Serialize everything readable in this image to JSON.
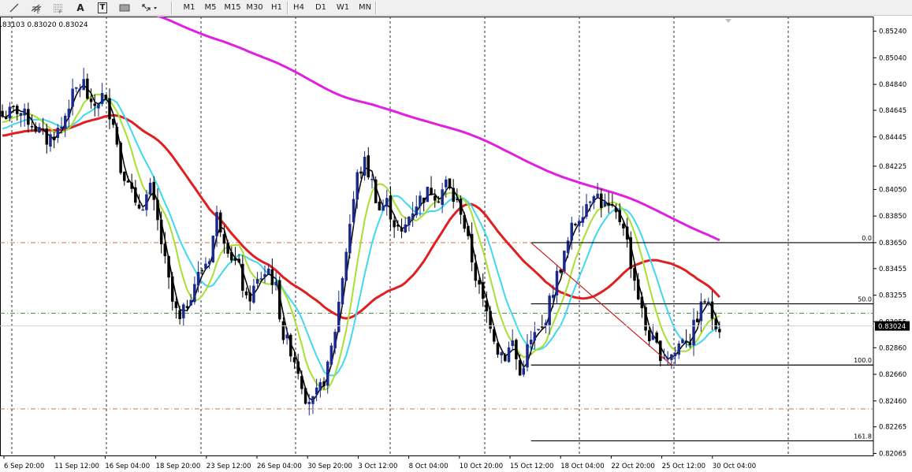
{
  "toolbar": {
    "tools": [
      {
        "name": "trendline-tool",
        "icon": "trendline-icon",
        "label": ""
      },
      {
        "name": "fibo-channel-tool",
        "icon": "hash-e-icon",
        "label": ""
      },
      {
        "name": "fibo-tool",
        "icon": "fibo-f-icon",
        "label": ""
      },
      {
        "name": "text-tool",
        "icon": "text-a-icon",
        "label": "A"
      },
      {
        "name": "text-label-tool",
        "icon": "text-t-icon",
        "label": "T"
      },
      {
        "name": "rectangle-tool",
        "icon": "rectangle-icon",
        "label": ""
      },
      {
        "name": "arrows-tool",
        "icon": "arrows-dropdown-icon",
        "label": ""
      }
    ],
    "timeframes": [
      "M1",
      "M5",
      "M15",
      "M30",
      "H1",
      "H4",
      "D1",
      "W1",
      "MN"
    ]
  },
  "chart": {
    "ohlc_text": ".83103 0.83020 0.83024",
    "current_price": "0.83024"
  },
  "chart_data": {
    "type": "candlestick",
    "ylim": [
      0.8205,
      0.8535
    ],
    "y_ticks": [
      "0.85240",
      "0.85040",
      "0.84840",
      "0.84645",
      "0.84445",
      "0.84225",
      "0.84050",
      "0.83850",
      "0.83650",
      "0.83455",
      "0.83255",
      "0.83055",
      "0.82860",
      "0.82660",
      "0.82460",
      "0.82265",
      "0.82065"
    ],
    "x_ticks": [
      "6 Sep 20:00",
      "11 Sep 12:00",
      "16 Sep 04:00",
      "18 Sep 20:00",
      "23 Sep 12:00",
      "26 Sep 04:00",
      "30 Sep 20:00",
      "3 Oct 12:00",
      "8 Oct 04:00",
      "10 Oct 20:00",
      "15 Oct 12:00",
      "18 Oct 04:00",
      "22 Oct 20:00",
      "25 Oct 12:00",
      "30 Oct 04:00"
    ],
    "close_anchors": [
      [
        0,
        0.846
      ],
      [
        4,
        0.8465
      ],
      [
        8,
        0.8455
      ],
      [
        12,
        0.8442
      ],
      [
        16,
        0.8452
      ],
      [
        18,
        0.847
      ],
      [
        20,
        0.848
      ],
      [
        22,
        0.8485
      ],
      [
        24,
        0.8465
      ],
      [
        27,
        0.8475
      ],
      [
        30,
        0.8458
      ],
      [
        32,
        0.842
      ],
      [
        34,
        0.8415
      ],
      [
        36,
        0.839
      ],
      [
        38,
        0.8395
      ],
      [
        40,
        0.8405
      ],
      [
        42,
        0.838
      ],
      [
        44,
        0.835
      ],
      [
        46,
        0.832
      ],
      [
        48,
        0.8305
      ],
      [
        50,
        0.832
      ],
      [
        52,
        0.8335
      ],
      [
        54,
        0.8345
      ],
      [
        56,
        0.8355
      ],
      [
        58,
        0.8385
      ],
      [
        60,
        0.837
      ],
      [
        62,
        0.8355
      ],
      [
        64,
        0.8345
      ],
      [
        66,
        0.832
      ],
      [
        68,
        0.833
      ],
      [
        70,
        0.834
      ],
      [
        72,
        0.8345
      ],
      [
        74,
        0.833
      ],
      [
        76,
        0.8295
      ],
      [
        78,
        0.8285
      ],
      [
        80,
        0.827
      ],
      [
        82,
        0.825
      ],
      [
        84,
        0.8245
      ],
      [
        86,
        0.8255
      ],
      [
        88,
        0.827
      ],
      [
        90,
        0.83
      ],
      [
        92,
        0.834
      ],
      [
        94,
        0.838
      ],
      [
        96,
        0.8415
      ],
      [
        98,
        0.8425
      ],
      [
        100,
        0.841
      ],
      [
        102,
        0.839
      ],
      [
        104,
        0.8395
      ],
      [
        106,
        0.838
      ],
      [
        108,
        0.837
      ],
      [
        110,
        0.8385
      ],
      [
        112,
        0.8395
      ],
      [
        114,
        0.84
      ],
      [
        116,
        0.8405
      ],
      [
        118,
        0.84
      ],
      [
        120,
        0.841
      ],
      [
        122,
        0.8398
      ],
      [
        124,
        0.839
      ],
      [
        126,
        0.8365
      ],
      [
        128,
        0.834
      ],
      [
        130,
        0.832
      ],
      [
        132,
        0.8305
      ],
      [
        134,
        0.8285
      ],
      [
        136,
        0.828
      ],
      [
        138,
        0.829
      ],
      [
        140,
        0.8265
      ],
      [
        142,
        0.8285
      ],
      [
        144,
        0.8295
      ],
      [
        146,
        0.83
      ],
      [
        148,
        0.832
      ],
      [
        150,
        0.834
      ],
      [
        152,
        0.8355
      ],
      [
        154,
        0.8375
      ],
      [
        156,
        0.8385
      ],
      [
        158,
        0.8395
      ],
      [
        160,
        0.8405
      ],
      [
        162,
        0.8395
      ],
      [
        164,
        0.839
      ],
      [
        166,
        0.8385
      ],
      [
        168,
        0.838
      ],
      [
        170,
        0.835
      ],
      [
        172,
        0.8325
      ],
      [
        174,
        0.83
      ],
      [
        176,
        0.829
      ],
      [
        178,
        0.8282
      ],
      [
        180,
        0.828
      ],
      [
        182,
        0.8282
      ],
      [
        184,
        0.8295
      ],
      [
        186,
        0.8292
      ],
      [
        188,
        0.831
      ],
      [
        190,
        0.8322
      ],
      [
        192,
        0.831
      ],
      [
        194,
        0.8302
      ]
    ],
    "horizontal_lines": [
      {
        "price": 0.8365,
        "style": "dash-dot",
        "color": "#d4582c"
      },
      {
        "price": 0.8312,
        "style": "dash-dot",
        "color": "#2f8a2f"
      },
      {
        "price": 0.824,
        "style": "dash-dot",
        "color": "#d4582c"
      }
    ],
    "fibonacci": {
      "levels": [
        {
          "label": "0.0",
          "price": 0.8365
        },
        {
          "label": "50.0",
          "price": 0.8319
        },
        {
          "label": "100.0",
          "price": 0.8273
        },
        {
          "label": "161.8",
          "price": 0.8216
        }
      ],
      "from_index": 143,
      "to_index": 220,
      "trend_from_price": 0.8365,
      "trend_to_price": 0.8273,
      "trend_to_index": 181
    },
    "moving_averages": [
      {
        "period": 200,
        "color": "#e020e0"
      },
      {
        "period": 34,
        "color": "#e02020"
      },
      {
        "period": 13,
        "color": "#40d8f0"
      },
      {
        "period": 8,
        "color": "#a8e030"
      },
      {
        "period": 3,
        "color": "#000000"
      }
    ],
    "bullish_color": "#1a2a8c",
    "bearish_color": "#000000",
    "current_price_line_color": "#d0d0d0"
  }
}
